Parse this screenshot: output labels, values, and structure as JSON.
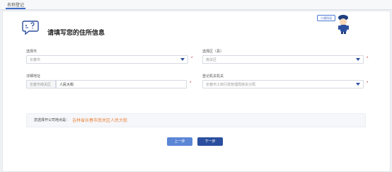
{
  "breadcrumb": {
    "label": "名称登记"
  },
  "header": {
    "title": "请填写您的住所信息"
  },
  "mascot": {
    "badge": "小通用语"
  },
  "fields": {
    "city": {
      "label": "选择市",
      "value": "长春市",
      "required": "*"
    },
    "district": {
      "label": "选择区（县）",
      "value": "南关区",
      "required": "*"
    },
    "address": {
      "label": "详细地址",
      "prefix": "长春市南关区",
      "value": "人民大街",
      "required": "*"
    },
    "authority": {
      "label": "登记机关机关",
      "value": "长春市工商行政管理局南关分局",
      "required": "*"
    }
  },
  "notice": {
    "label": "您选择开公司地点是：",
    "address": "吉林省长春市南关区人民大街"
  },
  "buttons": {
    "prev": "上一步",
    "next": "下一步"
  },
  "colors": {
    "primary": "#2b4f9e",
    "secondary": "#5b86d6",
    "accent": "#e8833a",
    "required": "#cc3333"
  }
}
